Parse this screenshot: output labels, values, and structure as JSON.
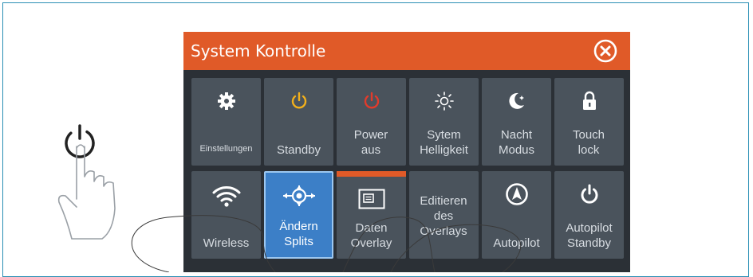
{
  "dialog": {
    "title": "System Kontrolle"
  },
  "tiles_row1": [
    {
      "label": "Einstellungen",
      "icon": "gear-icon"
    },
    {
      "label": "Standby",
      "icon": "standby-icon"
    },
    {
      "label": "Power aus",
      "icon": "power-off-icon"
    },
    {
      "label": "Sytem Helligkeit",
      "icon": "brightness-icon"
    },
    {
      "label": "Nacht Modus",
      "icon": "moon-icon"
    },
    {
      "label": "Touch lock",
      "icon": "lock-icon"
    }
  ],
  "tiles_row2": [
    {
      "label": "Wireless",
      "icon": "wifi-icon"
    },
    {
      "label": "Ändern Splits",
      "icon": "splits-icon"
    },
    {
      "label": "Daten Overlay",
      "icon": "data-overlay-icon"
    },
    {
      "label": "Editieren des Overlays",
      "icon": ""
    },
    {
      "label": "Autopilot",
      "icon": "autopilot-icon"
    },
    {
      "label": "Autopilot Standby",
      "icon": "autopilot-standby-icon"
    }
  ],
  "colors": {
    "header": "#e05a28",
    "panel": "#2b3036",
    "tile": "#4a535c",
    "selected": "#3c7fc7",
    "standby": "#f2b01c",
    "power_off": "#e23b2b",
    "frame": "#2a8fb4"
  }
}
